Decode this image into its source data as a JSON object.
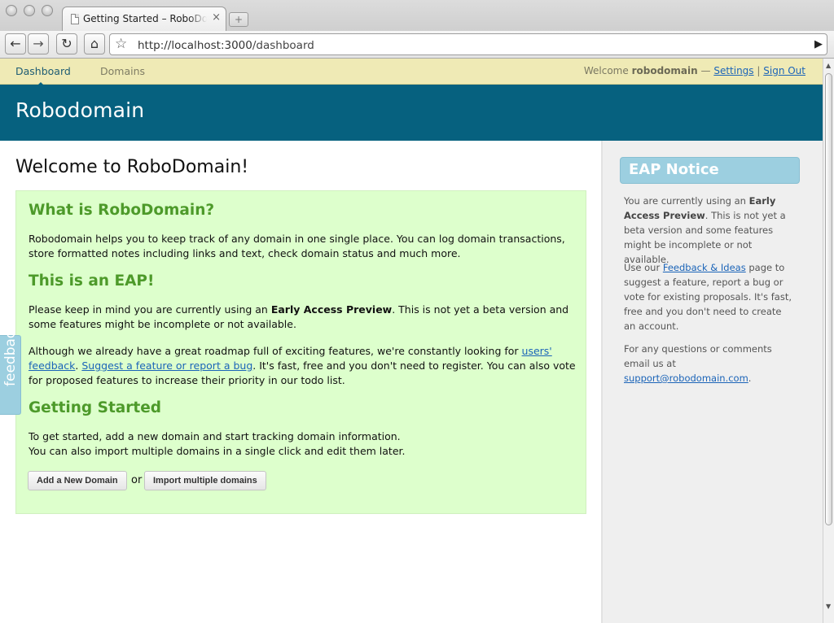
{
  "browser": {
    "tab_title": "Getting Started – RoboDomain",
    "tab_close": "×",
    "new_tab": "+",
    "url_host": "http://localhost:3000",
    "url_path": "/dashboard",
    "icons": [
      "back-arrow-icon",
      "forward-arrow-icon",
      "reload-icon",
      "home-icon",
      "bookmark-star-icon",
      "go-arrow-icon"
    ]
  },
  "nav": {
    "items": [
      {
        "label": "Dashboard",
        "active": true
      },
      {
        "label": "Domains",
        "active": false
      }
    ],
    "welcome": "Welcome",
    "username": "robodomain",
    "dash": "—",
    "settings": "Settings",
    "sep": "|",
    "sign_out": "Sign Out"
  },
  "brand": {
    "logo": "Robodomain"
  },
  "main": {
    "title": "Welcome to RoboDomain!",
    "h1": "What is RoboDomain?",
    "p1": "Robodomain helps you to keep track of any domain in one single place. You can log domain transactions, store formatted notes including links and text, check domain status and much more.",
    "h2": "This is an EAP!",
    "p2_a": "Please keep in mind you are currently using an ",
    "p2_b": "Early Access Preview",
    "p2_c": ". This is not yet a beta version and some features might be incomplete or not available.",
    "p3_a": "Although we already have a great roadmap full of exciting features, we're constantly looking for ",
    "p3_link1": "users' feedback",
    "p3_b": ". ",
    "p3_link2": "Suggest a feature or report a bug",
    "p3_c": ". It's fast, free and you don't need to register. You can also vote for proposed features to increase their priority in our todo list.",
    "h3": "Getting Started",
    "p4_line1": "To get started, add a new domain and start tracking domain information.",
    "p4_line2": "You can also import multiple domains in a single click and edit them later.",
    "btn_add": "Add a New Domain",
    "or": "or",
    "btn_import": "Import multiple domains"
  },
  "sidebar": {
    "heading": "EAP Notice",
    "s1_a": "You are currently using an ",
    "s1_b": "Early Access Preview",
    "s1_c": ". This is not yet a beta version and some features might be incomplete or not available.",
    "s2_a": "Use our ",
    "s2_link": "Feedback & Ideas",
    "s2_b": " page to suggest a feature, report a bug or vote for existing proposals. It's fast, free and you don't need to create an account.",
    "s3_a": "For any questions or comments email us at ",
    "s3_link": "support@robodomain.com",
    "s3_b": "."
  },
  "feedback_tab": "feedback",
  "colors": {
    "banner": "#06617f",
    "topnav": "#efeab5",
    "infobox": "#ddffcc",
    "heading_green": "#4d9a2a",
    "eap_blue": "#9ccfe0",
    "link": "#1b64b8"
  }
}
